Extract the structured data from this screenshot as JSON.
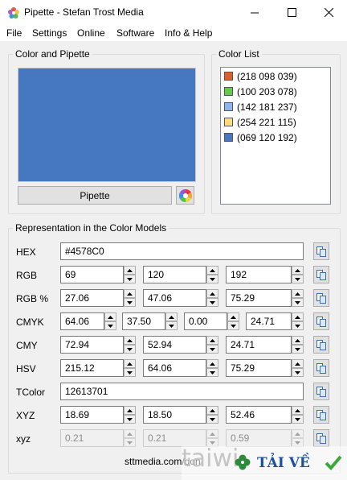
{
  "window": {
    "title": "Pipette - Stefan Trost Media"
  },
  "menu": [
    "File",
    "Settings",
    "Online",
    "Software",
    "Info & Help"
  ],
  "color_group": {
    "title": "Color and Pipette",
    "swatch_color": "#4578C0",
    "pipette_label": "Pipette"
  },
  "list_group": {
    "title": "Color List",
    "items": [
      {
        "label": "(218 098 039)",
        "color": "#DA6227"
      },
      {
        "label": "(100 203 078)",
        "color": "#64CB4E"
      },
      {
        "label": "(142 181 237)",
        "color": "#8EB5ED"
      },
      {
        "label": "(254 221 115)",
        "color": "#FEDD73"
      },
      {
        "label": "(069 120 192)",
        "color": "#4578C0"
      }
    ]
  },
  "models": {
    "title": "Representation in the Color Models",
    "hex": {
      "label": "HEX",
      "value": "#4578C0"
    },
    "rgb": {
      "label": "RGB",
      "v": [
        "69",
        "120",
        "192"
      ]
    },
    "rgbp": {
      "label": "RGB %",
      "v": [
        "27.06",
        "47.06",
        "75.29"
      ]
    },
    "cmyk": {
      "label": "CMYK",
      "v": [
        "64.06",
        "37.50",
        "0.00",
        "24.71"
      ]
    },
    "cmy": {
      "label": "CMY",
      "v": [
        "72.94",
        "52.94",
        "24.71"
      ]
    },
    "hsv": {
      "label": "HSV",
      "v": [
        "215.12",
        "64.06",
        "75.29"
      ]
    },
    "tcolor": {
      "label": "TColor",
      "value": "12613701"
    },
    "xyz": {
      "label": "XYZ",
      "v": [
        "18.69",
        "18.50",
        "52.46"
      ]
    },
    "xyz_small": {
      "label": "xyz",
      "v": [
        "0.21",
        "0.21",
        "0.59"
      ]
    }
  },
  "footer": "sttmedia.com/don",
  "watermark": {
    "brand": "taiwi",
    "text": "TẢI VỀ"
  }
}
